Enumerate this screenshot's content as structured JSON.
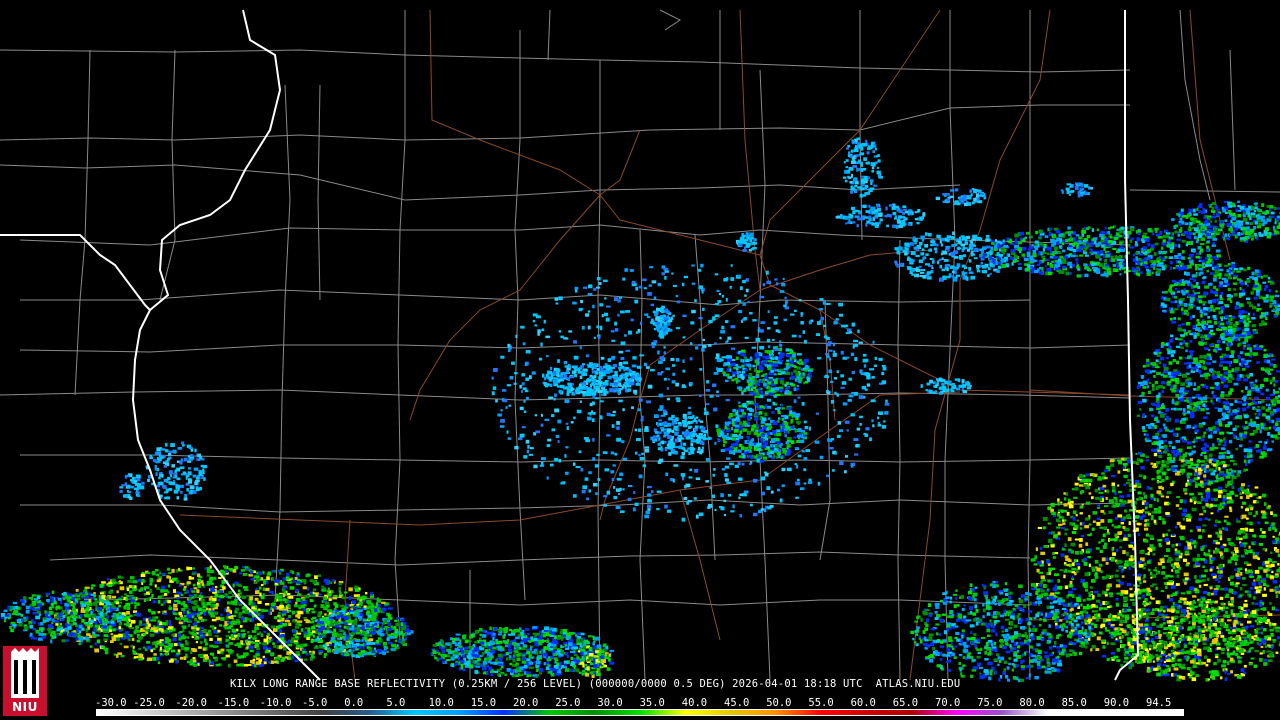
{
  "logo": {
    "text": "NIU"
  },
  "header": {
    "title": "KILX LONG RANGE BASE REFLECTIVITY (0.25KM / 256 LEVEL) (000000/0000 0.5 DEG) 2026-04-01 18:18 UTC  ATLAS.NIU.EDU"
  },
  "scale": {
    "labels": [
      "-30.0",
      "-25.0",
      "-20.0",
      "-15.0",
      "-10.0",
      "-5.0",
      "0.0",
      "5.0",
      "10.0",
      "15.0",
      "20.0",
      "25.0",
      "30.0",
      "35.0",
      "40.0",
      "45.0",
      "50.0",
      "55.0",
      "60.0",
      "65.0",
      "70.0",
      "75.0",
      "80.0",
      "85.0",
      "90.0",
      "94.5"
    ],
    "colors": [
      "#ffffff",
      "#d9d9d9",
      "#b3b3b3",
      "#8c8c8c",
      "#666666",
      "#404040",
      "#2a5a8a",
      "#00c8ff",
      "#00a0ff",
      "#0030ff",
      "#00c800",
      "#009000",
      "#00e000",
      "#ffff00",
      "#e6c800",
      "#ff9000",
      "#ff0000",
      "#d00000",
      "#b00000",
      "#ff00ff",
      "#9955c9",
      "#ffffff",
      "#ffffff",
      "#ffffff",
      "#ffffff"
    ]
  }
}
